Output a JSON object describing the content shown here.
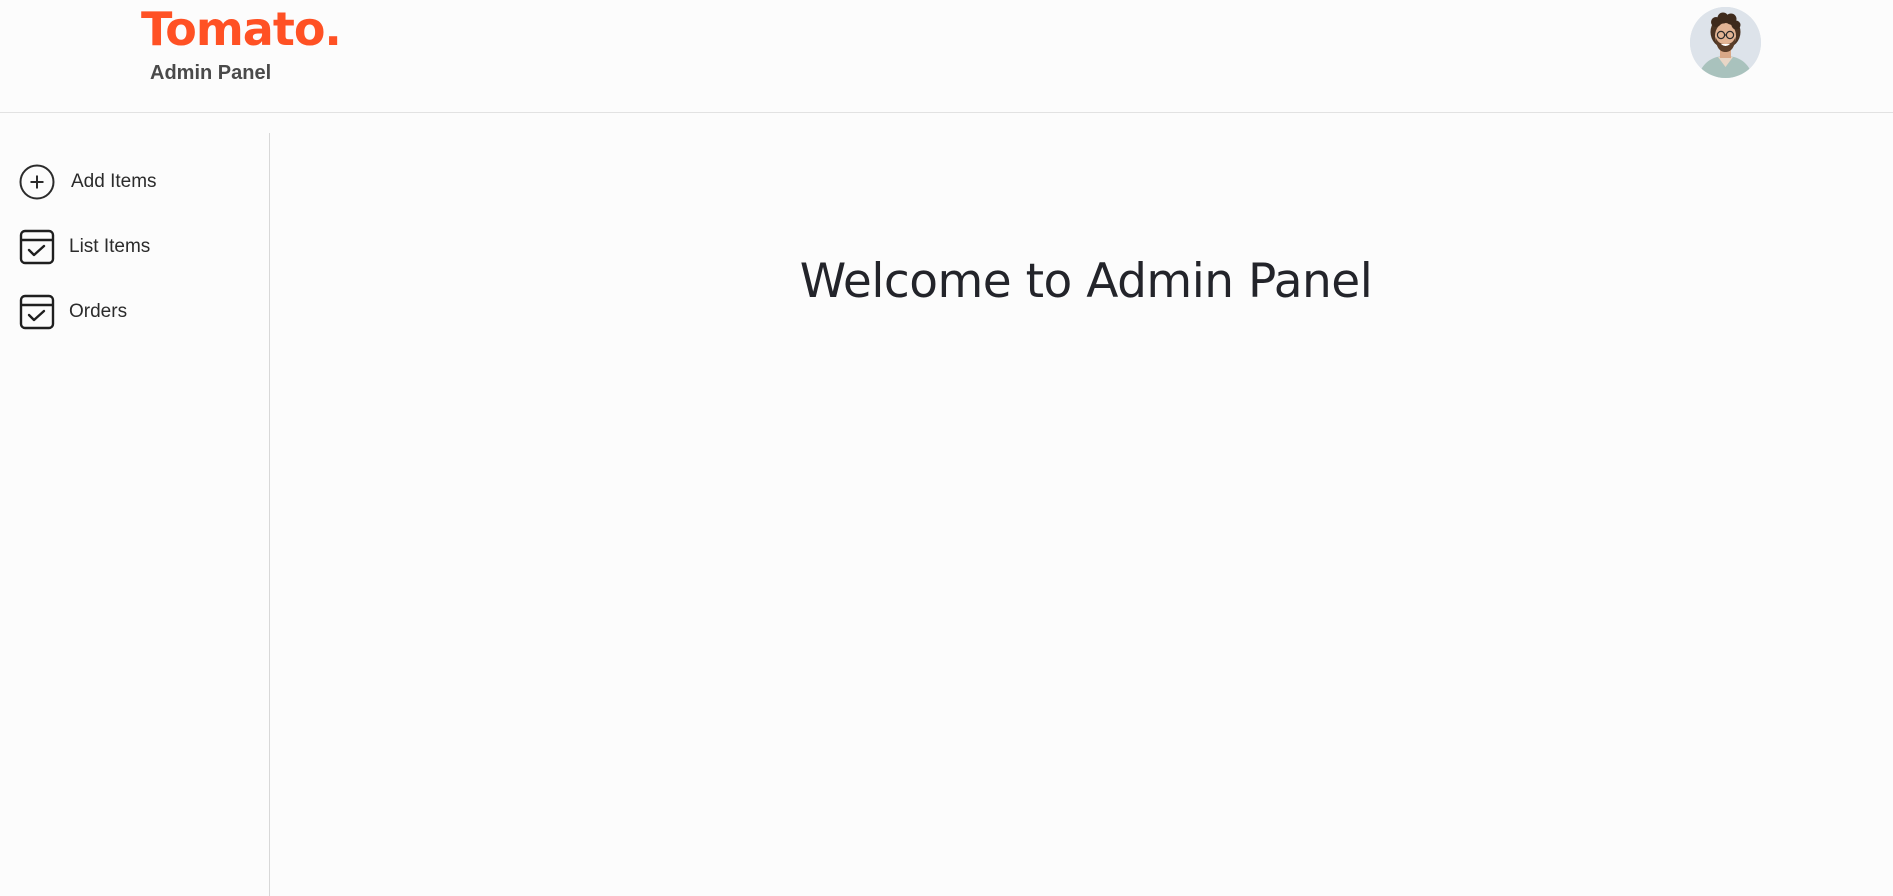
{
  "brand": {
    "logo_text": "Tomato.",
    "subtitle": "Admin Panel",
    "accent_color": "#ff5124"
  },
  "header": {
    "avatar_icon": "profile-avatar"
  },
  "sidebar": {
    "items": [
      {
        "label": "Add Items",
        "icon": "add-circle-icon"
      },
      {
        "label": "List Items",
        "icon": "checklist-icon"
      },
      {
        "label": "Orders",
        "icon": "checklist-icon"
      }
    ]
  },
  "main": {
    "heading": "Welcome to Admin Panel"
  }
}
